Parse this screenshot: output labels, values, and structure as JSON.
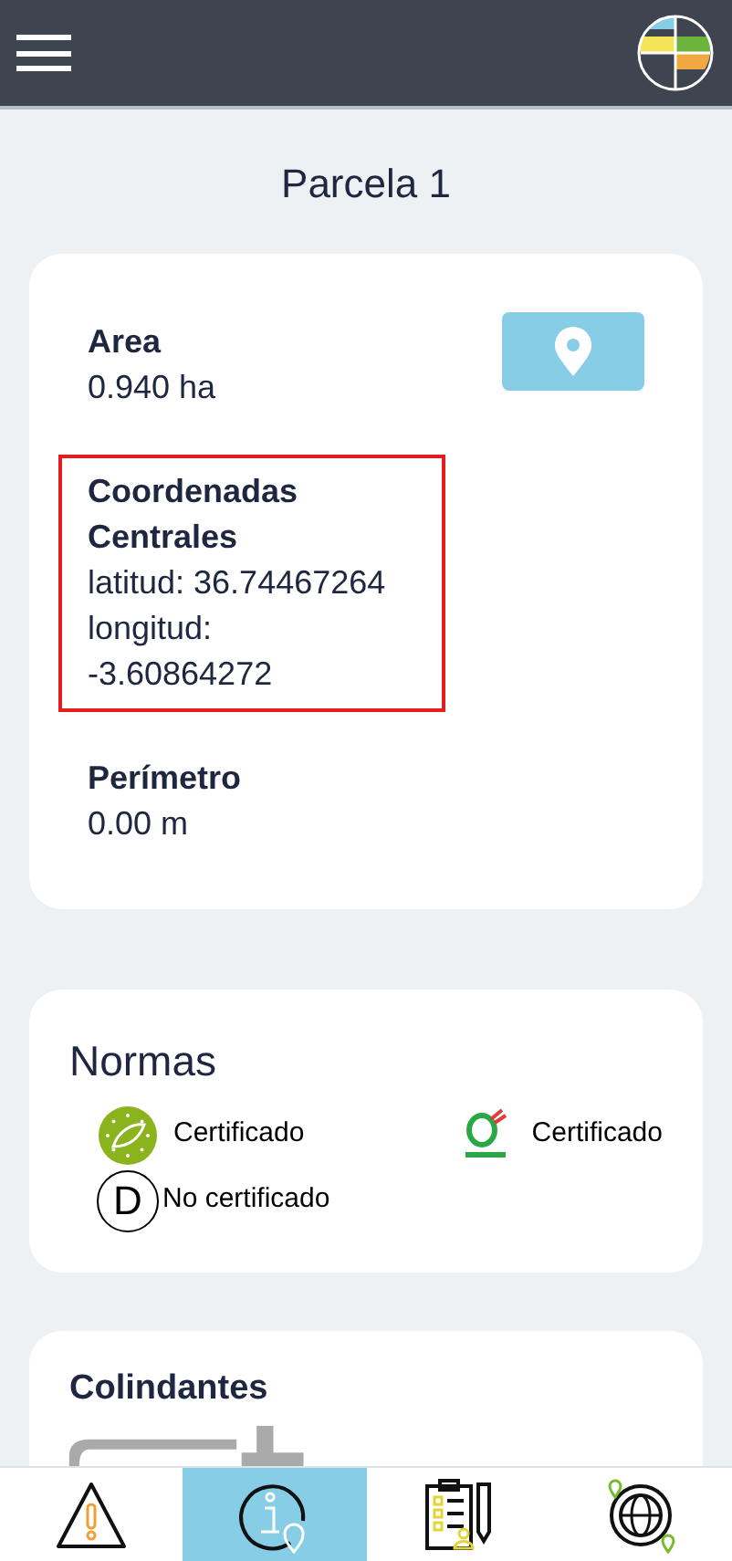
{
  "title": "Parcela 1",
  "details": {
    "fields": [
      {
        "label": "Area",
        "lines": [
          "0.940 ha"
        ],
        "highlighted": false
      },
      {
        "label": "Coordenadas Centrales",
        "lines": [
          "latitud: 36.74467264",
          "longitud:",
          "-3.60864272"
        ],
        "highlighted": true
      },
      {
        "label": "Perímetro",
        "lines": [
          "0.00 m"
        ],
        "highlighted": false
      }
    ]
  },
  "normas": {
    "title": "Normas",
    "items": [
      {
        "kind": "eu-leaf",
        "status": "Certificado"
      },
      {
        "kind": "bio-suisse",
        "status": "Certificado"
      },
      {
        "kind": "letter",
        "letter": "D",
        "status": "No certificado"
      }
    ]
  },
  "colindantes": {
    "title": "Colindantes"
  },
  "nav": [
    {
      "kind": "warning",
      "selected": false
    },
    {
      "kind": "info",
      "selected": true
    },
    {
      "kind": "checklist",
      "selected": false
    },
    {
      "kind": "globe",
      "selected": false
    }
  ]
}
